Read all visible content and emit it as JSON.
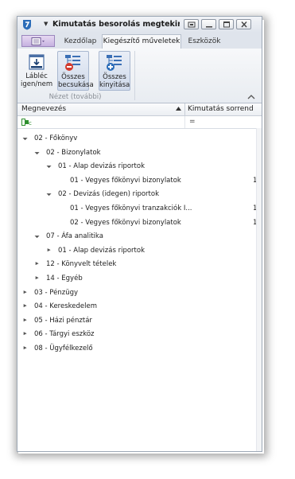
{
  "window": {
    "title": "Kimutatás besorolás megtekinté...",
    "menu_arrow": "▼"
  },
  "ribbon": {
    "tabs": [
      {
        "label": "Kezdőlap",
        "active": false
      },
      {
        "label": "Kiegészítő műveletek",
        "active": true
      },
      {
        "label": "Eszközök",
        "active": false
      }
    ],
    "buttons": [
      {
        "label_line1": "Lábléc",
        "label_line2": "igen/nem",
        "icon": "footer-toggle-icon"
      },
      {
        "label_line1": "Összes",
        "label_line2": "becsukása",
        "icon": "collapse-all-icon"
      },
      {
        "label_line1": "Összes",
        "label_line2": "kinyitása",
        "icon": "expand-all-icon"
      }
    ],
    "group_label": "Nézet (további)"
  },
  "grid": {
    "columns": [
      "Megnevezés",
      "Kimutatás sorrend"
    ],
    "filter_operator": "="
  },
  "tree": [
    {
      "level": 0,
      "expander": "expanded",
      "label": "02 - Főkönyv",
      "value": ""
    },
    {
      "level": 1,
      "expander": "expanded",
      "label": "02 - Bizonylatok",
      "value": ""
    },
    {
      "level": 2,
      "expander": "expanded",
      "label": "01 - Alap devizás riportok",
      "value": ""
    },
    {
      "level": 3,
      "expander": "none",
      "label": "01 - Vegyes főkönyvi bizonylatok",
      "value": "1"
    },
    {
      "level": 2,
      "expander": "expanded",
      "label": "02 - Devizás (idegen) riportok",
      "value": ""
    },
    {
      "level": 3,
      "expander": "none",
      "label": "01 - Vegyes főkönyvi tranzakciók I...",
      "value": "1"
    },
    {
      "level": 3,
      "expander": "none",
      "label": "02 - Vegyes főkönyvi bizonylatok",
      "value": "1"
    },
    {
      "level": 1,
      "expander": "expanded",
      "label": "07 - Áfa analitika",
      "value": ""
    },
    {
      "level": 2,
      "expander": "collapsed",
      "label": "01 - Alap devizás riportok",
      "value": ""
    },
    {
      "level": 1,
      "expander": "collapsed",
      "label": "12 - Könyvelt tételek",
      "value": ""
    },
    {
      "level": 1,
      "expander": "collapsed",
      "label": "14 - Egyéb",
      "value": ""
    },
    {
      "level": 0,
      "expander": "collapsed",
      "label": "03 - Pénzügy",
      "value": ""
    },
    {
      "level": 0,
      "expander": "collapsed",
      "label": "04 - Kereskedelem",
      "value": ""
    },
    {
      "level": 0,
      "expander": "collapsed",
      "label": "05 - Házi pénztár",
      "value": ""
    },
    {
      "level": 0,
      "expander": "collapsed",
      "label": "06 - Tárgyi eszköz",
      "value": ""
    },
    {
      "level": 0,
      "expander": "collapsed",
      "label": "08 - Ügyfélkezelő",
      "value": ""
    }
  ],
  "colors": {
    "accent": "#2b6cb8",
    "frame": "#9da8b6",
    "active_tab": "#f7f8fa"
  }
}
